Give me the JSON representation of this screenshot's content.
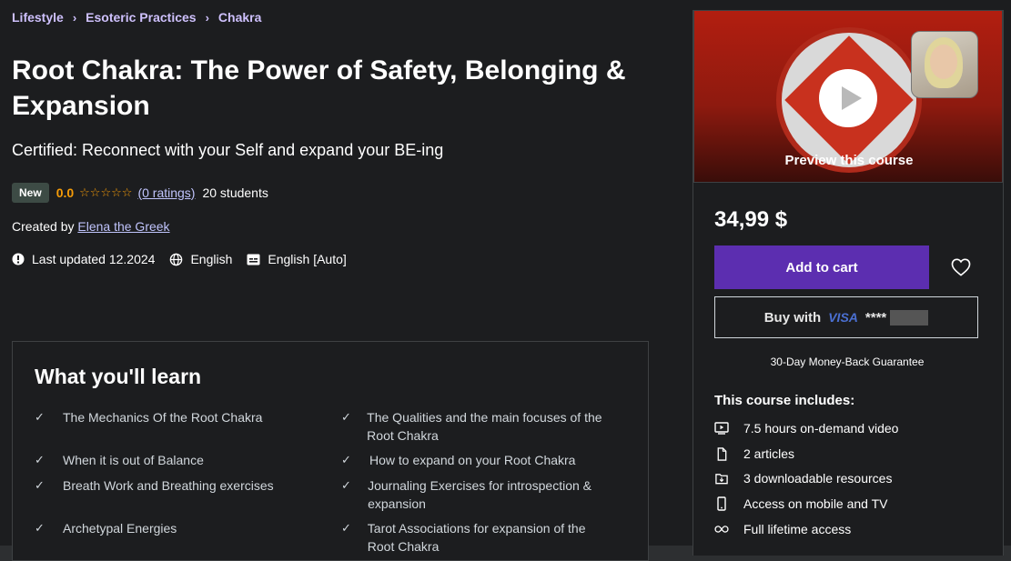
{
  "breadcrumb": [
    "Lifestyle",
    "Esoteric Practices",
    "Chakra"
  ],
  "course": {
    "title": "Root Chakra: The Power of Safety, Belonging & Expansion",
    "subtitle": "Certified: Reconnect with your Self and expand your BE-ing",
    "badge": "New",
    "rating": "0.0",
    "stars": "☆☆☆☆☆",
    "ratings_link": "(0 ratings)",
    "students": "20 students",
    "created_by_label": "Created by",
    "instructor": "Elena the Greek",
    "last_updated": "Last updated 12.2024",
    "language": "English",
    "captions": "English [Auto]"
  },
  "learn": {
    "title": "What you'll learn",
    "items": [
      "The Mechanics Of the Root Chakra",
      "The Qualities and the main focuses of the Root Chakra",
      "When it is out of Balance",
      "How to expand on your Root Chakra",
      "Breath Work and Breathing exercises",
      "Journaling Exercises for introspection & expansion",
      "Archetypal Energies",
      "Tarot Associations for expansion of the Root Chakra"
    ]
  },
  "sidebar": {
    "preview_label": "Preview this course",
    "price": "34,99 $",
    "add_to_cart": "Add to cart",
    "buy_with": "Buy with",
    "card_brand": "VISA",
    "card_mask": "****",
    "guarantee": "30-Day Money-Back Guarantee",
    "includes_title": "This course includes:",
    "includes": [
      {
        "icon": "video-icon",
        "text": "7.5 hours on-demand video"
      },
      {
        "icon": "file-icon",
        "text": "2 articles"
      },
      {
        "icon": "download-icon",
        "text": "3 downloadable resources"
      },
      {
        "icon": "mobile-icon",
        "text": "Access on mobile and TV"
      },
      {
        "icon": "infinity-icon",
        "text": "Full lifetime access"
      }
    ]
  },
  "colors": {
    "accent_purple": "#5c2eb0",
    "link": "#c0c4fc",
    "rating": "#f69c08"
  }
}
